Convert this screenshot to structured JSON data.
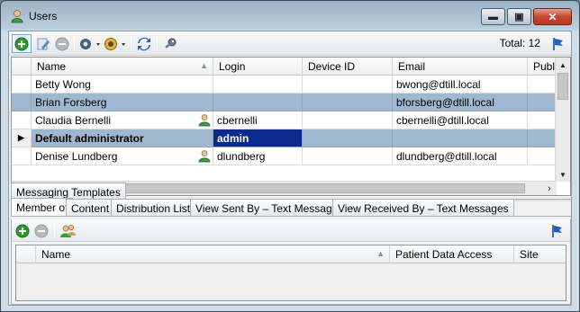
{
  "window": {
    "title": "Users"
  },
  "toolbar": {
    "total_label": "Total: 12",
    "icons": [
      "add-icon",
      "edit-icon",
      "remove-icon",
      "settings-icon",
      "filter-icon",
      "refresh-icon",
      "key-icon",
      "pin-icon"
    ]
  },
  "users_grid": {
    "columns": [
      "Name",
      "Login",
      "Device ID",
      "Email",
      "Public"
    ],
    "rows": [
      {
        "name": "Betty Wong",
        "login": "",
        "device_id": "",
        "email": "bwong@dtill.local",
        "public": "",
        "has_user_icon": false,
        "state": "normal"
      },
      {
        "name": "Brian Forsberg",
        "login": "",
        "device_id": "",
        "email": "bforsberg@dtill.local",
        "public": "",
        "has_user_icon": false,
        "state": "selected"
      },
      {
        "name": "Claudia Bernelli",
        "login": "cbernelli",
        "device_id": "",
        "email": "cbernelli@dtill.local",
        "public": "",
        "has_user_icon": true,
        "state": "normal"
      },
      {
        "name": "Default administrator",
        "login": "admin",
        "device_id": "",
        "email": "",
        "public": "",
        "has_user_icon": false,
        "state": "current"
      },
      {
        "name": "Denise Lundberg",
        "login": "dlundberg",
        "device_id": "",
        "email": "dlundberg@dtill.local",
        "public": "",
        "has_user_icon": true,
        "state": "normal"
      }
    ]
  },
  "tabs_top": [
    {
      "label": "Messaging Templates"
    }
  ],
  "tabs_bottom": [
    {
      "label": "Member of",
      "active": true
    },
    {
      "label": "Content",
      "active": false
    },
    {
      "label": "Distribution Lists",
      "active": false
    },
    {
      "label": "View Sent By – Text Messages",
      "active": false
    },
    {
      "label": "View Received By – Text Messages",
      "active": false
    }
  ],
  "member_grid": {
    "columns": [
      "Name",
      "Patient Data Access",
      "Site"
    ]
  },
  "colors": {
    "selection": "#9fb8cf",
    "edit_cell": "#0a2a8f",
    "add_green": "#2e9b2e"
  }
}
